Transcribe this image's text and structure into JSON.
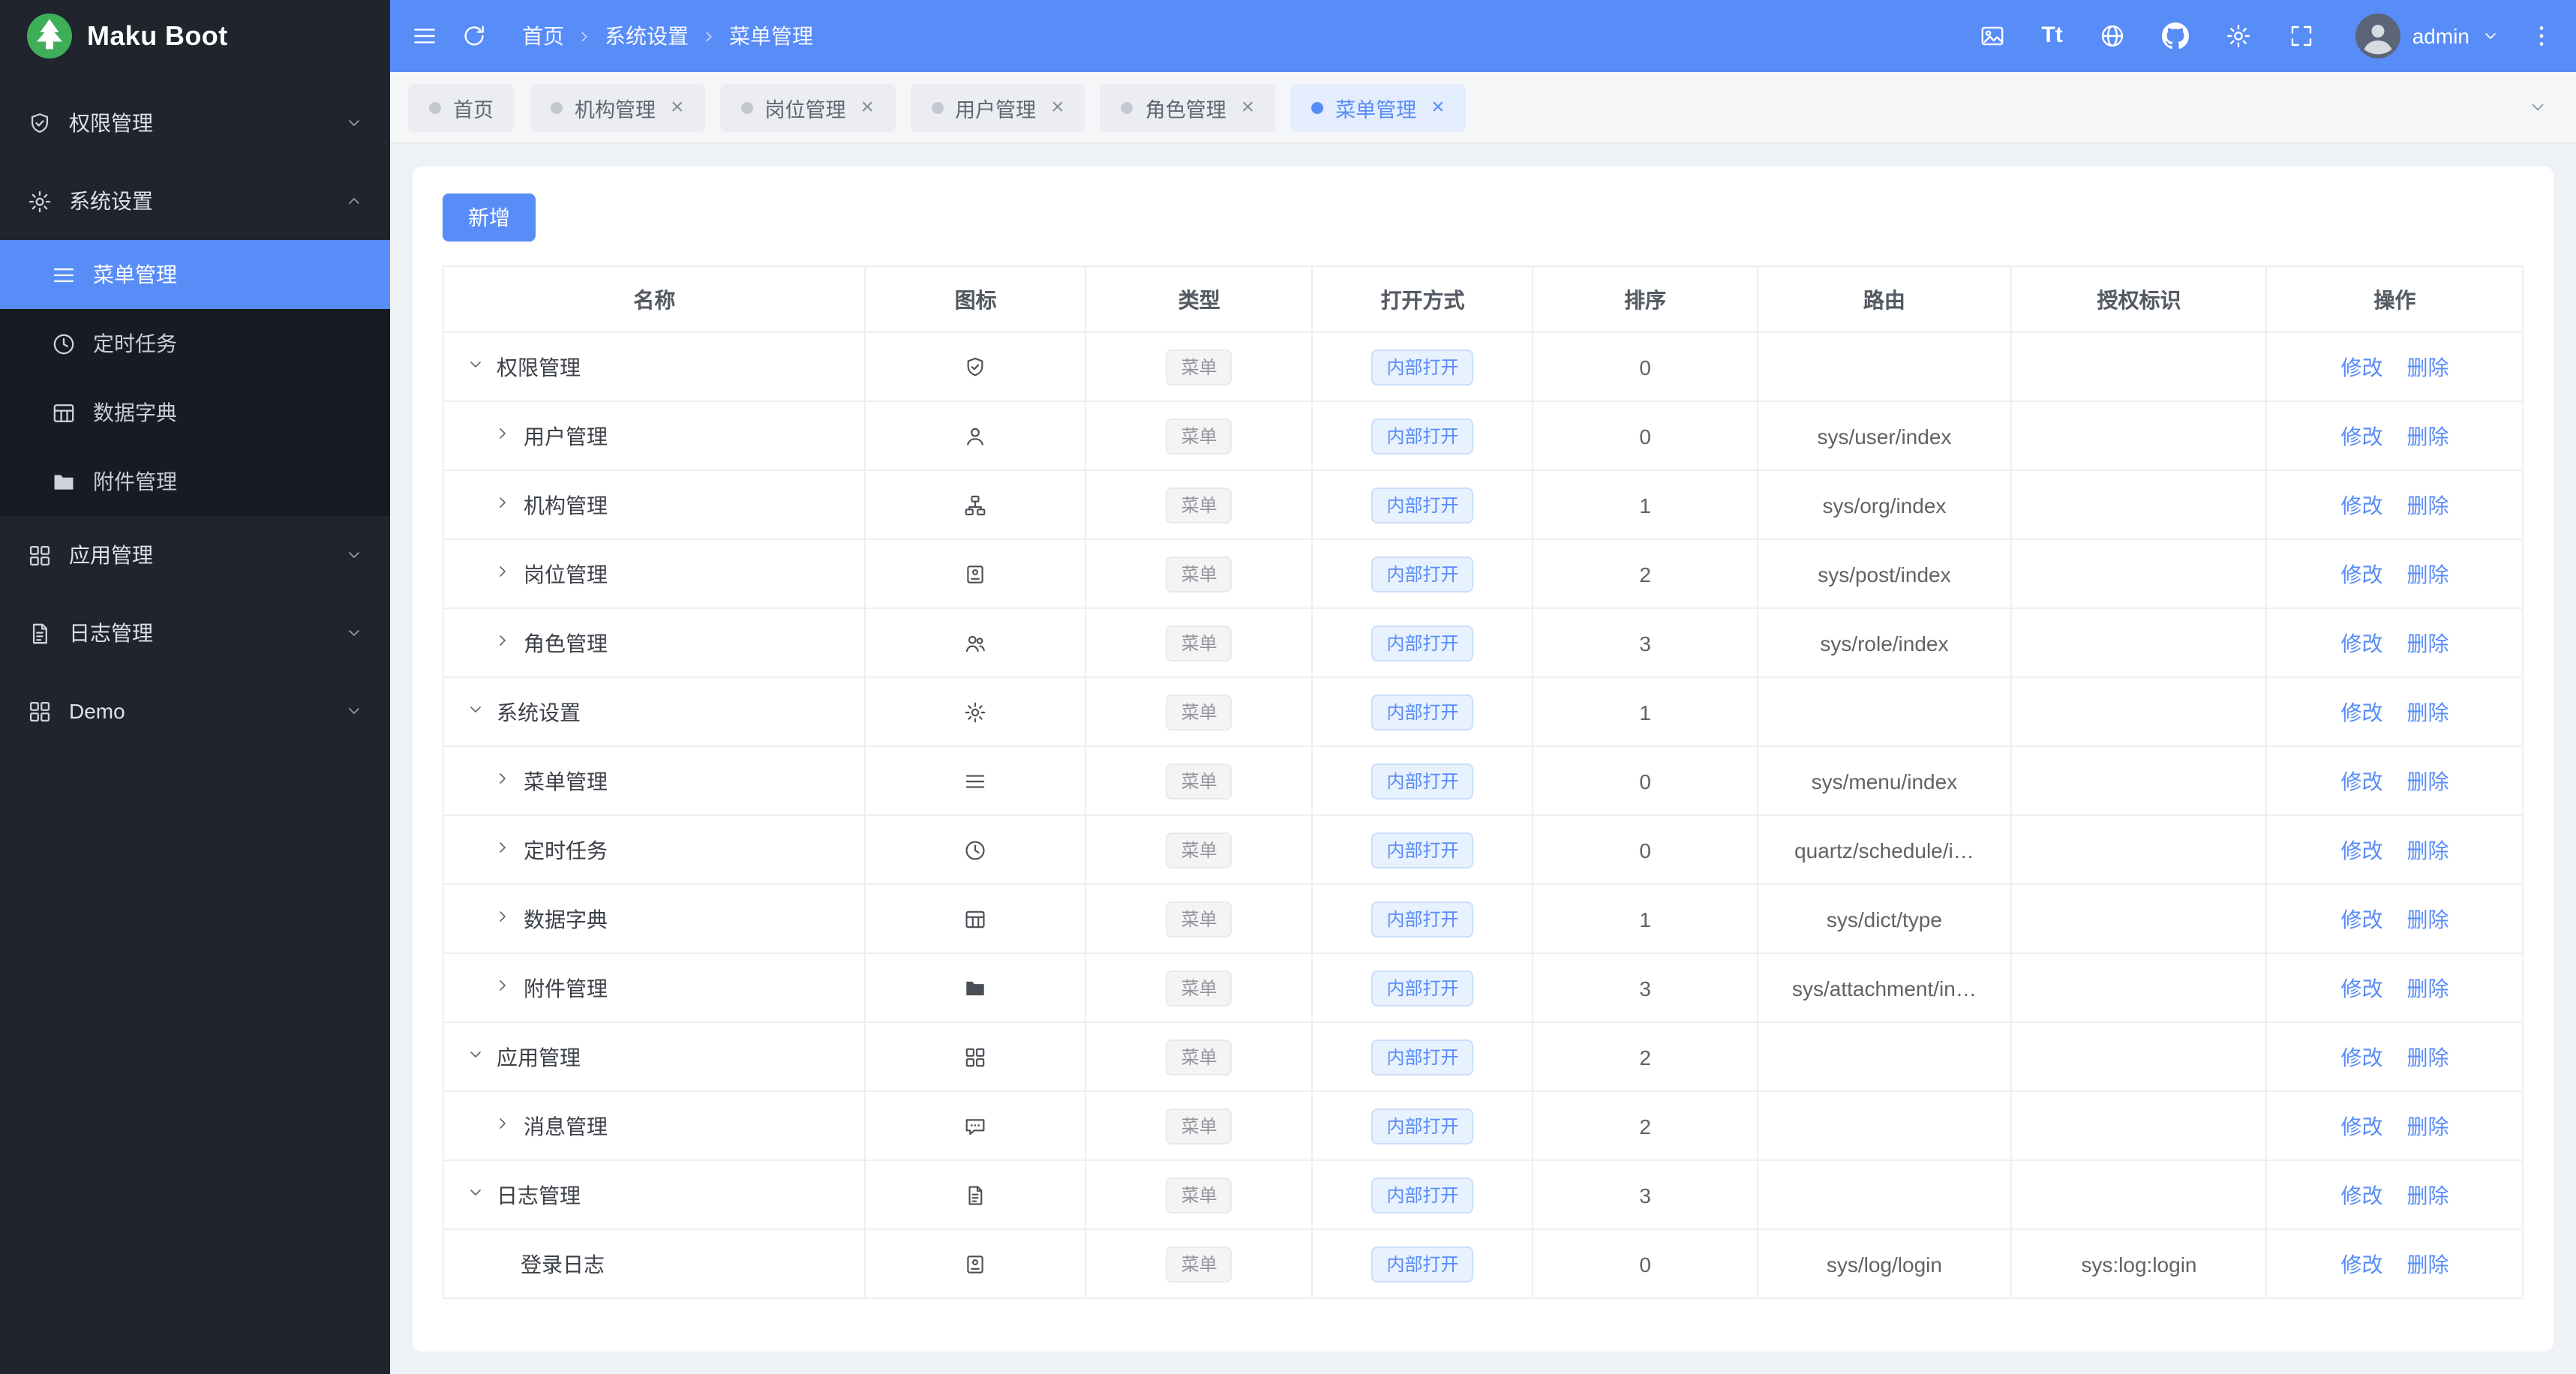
{
  "app": {
    "title": "Maku Boot"
  },
  "header": {
    "breadcrumb": [
      "首页",
      "系统设置",
      "菜单管理"
    ],
    "actions": [
      {
        "icon": "image"
      },
      {
        "icon": "font-size",
        "label": "Tt"
      },
      {
        "icon": "globe"
      },
      {
        "icon": "github"
      },
      {
        "icon": "settings"
      },
      {
        "icon": "fullscreen"
      }
    ],
    "user": "admin"
  },
  "tabs": {
    "items": [
      {
        "key": "home",
        "label": "首页",
        "closable": false,
        "active": false
      },
      {
        "key": "org",
        "label": "机构管理",
        "closable": true,
        "active": false
      },
      {
        "key": "post",
        "label": "岗位管理",
        "closable": true,
        "active": false
      },
      {
        "key": "user",
        "label": "用户管理",
        "closable": true,
        "active": false
      },
      {
        "key": "role",
        "label": "角色管理",
        "closable": true,
        "active": false
      },
      {
        "key": "menu",
        "label": "菜单管理",
        "closable": true,
        "active": true
      }
    ]
  },
  "sidebar": {
    "items": [
      {
        "key": "permissions",
        "label": "权限管理",
        "icon": "shield",
        "expanded": false
      },
      {
        "key": "system-settings",
        "label": "系统设置",
        "icon": "gear",
        "expanded": true,
        "children": [
          {
            "key": "menu-management",
            "label": "菜单管理",
            "icon": "menu",
            "active": true
          },
          {
            "key": "scheduled-tasks",
            "label": "定时任务",
            "icon": "clock",
            "active": false
          },
          {
            "key": "data-dictionary",
            "label": "数据字典",
            "icon": "table",
            "active": false
          },
          {
            "key": "attachments",
            "label": "附件管理",
            "icon": "folder",
            "active": false
          }
        ]
      },
      {
        "key": "app-management",
        "label": "应用管理",
        "icon": "grid",
        "expanded": false
      },
      {
        "key": "log-management",
        "label": "日志管理",
        "icon": "document",
        "expanded": false
      },
      {
        "key": "demo",
        "label": "Demo",
        "icon": "grid",
        "expanded": false
      }
    ]
  },
  "toolbar": {
    "add_label": "新增"
  },
  "table": {
    "headers": [
      "名称",
      "图标",
      "类型",
      "打开方式",
      "排序",
      "路由",
      "授权标识",
      "操作"
    ],
    "type_tag": "菜单",
    "open_tag": "内部打开",
    "edit_label": "修改",
    "delete_label": "删除",
    "rows": [
      {
        "name": "权限管理",
        "level": 0,
        "arrow": "down",
        "icon": "shield",
        "sort": "0",
        "route": "",
        "auth": ""
      },
      {
        "name": "用户管理",
        "level": 1,
        "arrow": "right",
        "icon": "user",
        "sort": "0",
        "route": "sys/user/index",
        "auth": ""
      },
      {
        "name": "机构管理",
        "level": 1,
        "arrow": "right",
        "icon": "org",
        "sort": "1",
        "route": "sys/org/index",
        "auth": ""
      },
      {
        "name": "岗位管理",
        "level": 1,
        "arrow": "right",
        "icon": "badge",
        "sort": "2",
        "route": "sys/post/index",
        "auth": ""
      },
      {
        "name": "角色管理",
        "level": 1,
        "arrow": "right",
        "icon": "users",
        "sort": "3",
        "route": "sys/role/index",
        "auth": ""
      },
      {
        "name": "系统设置",
        "level": 0,
        "arrow": "down",
        "icon": "gear",
        "sort": "1",
        "route": "",
        "auth": ""
      },
      {
        "name": "菜单管理",
        "level": 1,
        "arrow": "right",
        "icon": "menu",
        "sort": "0",
        "route": "sys/menu/index",
        "auth": ""
      },
      {
        "name": "定时任务",
        "level": 1,
        "arrow": "right",
        "icon": "clock",
        "sort": "0",
        "route": "quartz/schedule/i…",
        "auth": ""
      },
      {
        "name": "数据字典",
        "level": 1,
        "arrow": "right",
        "icon": "table",
        "sort": "1",
        "route": "sys/dict/type",
        "auth": ""
      },
      {
        "name": "附件管理",
        "level": 1,
        "arrow": "right",
        "icon": "folder",
        "sort": "3",
        "route": "sys/attachment/in…",
        "auth": ""
      },
      {
        "name": "应用管理",
        "level": 0,
        "arrow": "down",
        "icon": "grid",
        "sort": "2",
        "route": "",
        "auth": ""
      },
      {
        "name": "消息管理",
        "level": 1,
        "arrow": "right",
        "icon": "message",
        "sort": "2",
        "route": "",
        "auth": ""
      },
      {
        "name": "日志管理",
        "level": 0,
        "arrow": "down",
        "icon": "document",
        "sort": "3",
        "route": "",
        "auth": ""
      },
      {
        "name": "登录日志",
        "level": 1,
        "arrow": "none",
        "icon": "badge",
        "sort": "0",
        "route": "sys/log/login",
        "auth": "sys:log:login"
      }
    ]
  },
  "colors": {
    "primary": "#588CF7",
    "sidebar_bg": "#1F242D",
    "sidebar_submenu_bg": "#171B22",
    "logo_green": "#3FAE59",
    "tag_info_text": "#909399",
    "tag_primary_bg": "#E8F1FE",
    "active_tab_bg": "#E3EDFE",
    "link": "#588CF7"
  }
}
